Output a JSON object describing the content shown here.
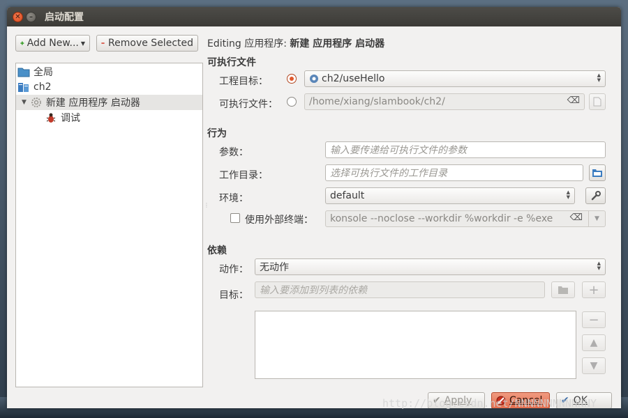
{
  "window": {
    "title": "启动配置"
  },
  "toolbar": {
    "add_new_label": "Add New...",
    "remove_selected_label": "Remove Selected"
  },
  "tree": {
    "items": [
      {
        "label": "全局",
        "icon": "folder-icon"
      },
      {
        "label": "ch2",
        "icon": "project-icon"
      },
      {
        "label": "新建 应用程序 启动器",
        "icon": "gear-icon",
        "expanded": true,
        "selected": true
      },
      {
        "label": "调试",
        "icon": "bug-icon"
      }
    ]
  },
  "editing": {
    "prefix": "Editing 应用程序:",
    "name": "新建 应用程序 启动器"
  },
  "executable": {
    "section": "可执行文件",
    "project_target_label": "工程目标：",
    "project_target_value": "ch2/useHello",
    "executable_label": "可执行文件：",
    "executable_value": "/home/xiang/slambook/ch2/"
  },
  "behavior": {
    "section": "行为",
    "args_label": "参数：",
    "args_placeholder": "输入要传递给可执行文件的参数",
    "workdir_label": "工作目录：",
    "workdir_placeholder": "选择可执行文件的工作目录",
    "env_label": "环境：",
    "env_value": "default",
    "terminal_label": "使用外部终端：",
    "terminal_value": "konsole --noclose --workdir %workdir -e %exe"
  },
  "dependencies": {
    "section": "依赖",
    "action_label": "动作：",
    "action_value": "无动作",
    "target_label": "目标：",
    "target_placeholder": "输入要添加到列表的依赖"
  },
  "footer": {
    "apply_label": "Apply",
    "cancel_label": "Cancel",
    "ok_label": "OK"
  },
  "watermark": "http://blog.csdn.net/NNNNNNNNNNNNY",
  "colors": {
    "accent": "#e0582c",
    "cancel_bg": "#e8775a",
    "titlebar": "#3c3b37"
  }
}
